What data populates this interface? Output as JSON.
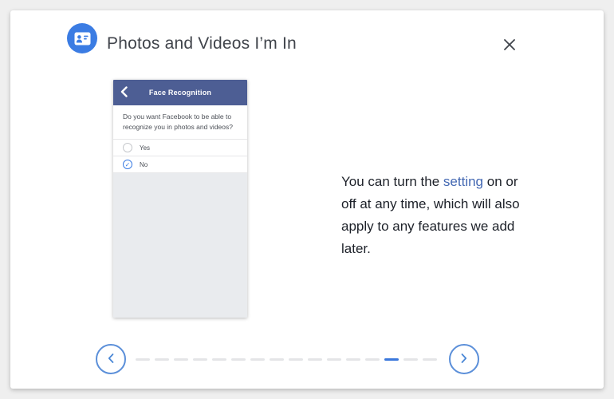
{
  "dialog": {
    "title": "Photos and Videos I’m In"
  },
  "phone": {
    "header_title": "Face Recognition",
    "question": "Do you want Facebook to be able to recognize you in photos and videos?",
    "options": [
      {
        "label": "Yes",
        "selected": false
      },
      {
        "label": "No",
        "selected": true
      }
    ]
  },
  "caption": {
    "before_link": "You can turn the ",
    "link": "setting",
    "after_link": " on or off at any time, which will also apply to any features we add later."
  },
  "carousel": {
    "total_segments": 16,
    "active_segment_index": 13
  },
  "icons": {
    "header_icon": "contact-card",
    "close": "x-cross",
    "phone_back": "chevron-left",
    "selected_option": "check",
    "check_glyph": "✓",
    "prev": "chevron-left",
    "next": "chevron-right"
  },
  "colors": {
    "accent_blue": "#3b7ce3",
    "phone_header_blue": "#4d5e94",
    "link_blue": "#4267b2",
    "active_dash_blue": "#3b78dc",
    "carousel_ring_blue": "#5b8fd9"
  }
}
